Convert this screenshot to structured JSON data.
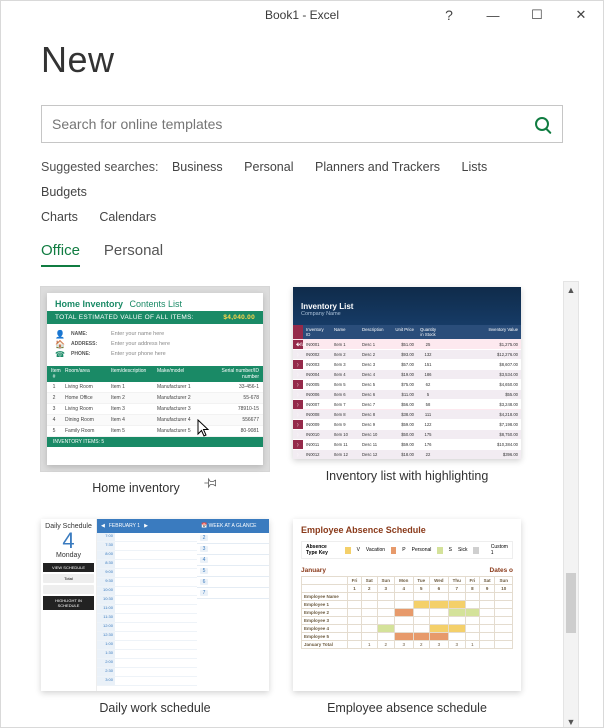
{
  "titlebar": {
    "title": "Book1  -  Excel",
    "help": "?",
    "min": "—",
    "max": "☐",
    "close": "✕"
  },
  "page": {
    "heading": "New"
  },
  "search": {
    "placeholder": "Search for online templates"
  },
  "suggested": {
    "label": "Suggested searches:",
    "items": [
      "Business",
      "Personal",
      "Planners and Trackers",
      "Lists",
      "Budgets",
      "Charts",
      "Calendars"
    ]
  },
  "tabs": {
    "active": "Office",
    "other": "Personal"
  },
  "templates": [
    {
      "id": "home-inventory",
      "caption": "Home inventory",
      "selected": true
    },
    {
      "id": "inventory-highlight",
      "caption": "Inventory list with highlighting",
      "selected": false
    },
    {
      "id": "daily-schedule",
      "caption": "Daily work schedule",
      "selected": false
    },
    {
      "id": "absence-schedule",
      "caption": "Employee absence schedule",
      "selected": false
    }
  ],
  "thumb1": {
    "title1": "Home Inventory",
    "title2": "Contents List",
    "barLabel": "TOTAL ESTIMATED VALUE OF ALL ITEMS:",
    "barValue": "$4,040.00",
    "infoRows": [
      {
        "icon": "👤",
        "k": "NAME:",
        "v": "Enter your name here"
      },
      {
        "icon": "🏠",
        "k": "ADDRESS:",
        "v": "Enter your address here"
      },
      {
        "icon": "☎",
        "k": "PHONE:",
        "v": "Enter your phone here"
      }
    ],
    "headers": [
      "Item #",
      "Room/area",
      "Item/description",
      "Make/model",
      "Serial number/ID number"
    ],
    "rows": [
      [
        "1",
        "Living Room",
        "Item 1",
        "Manufacturer 1",
        "33-456-1"
      ],
      [
        "2",
        "Home Office",
        "Item 2",
        "Manufacturer 2",
        "55-678"
      ],
      [
        "3",
        "Living Room",
        "Item 3",
        "Manufacturer 3",
        "78910-15"
      ],
      [
        "4",
        "Dining Room",
        "Item 4",
        "Manufacturer 4",
        "556677"
      ],
      [
        "5",
        "Family Room",
        "Item 5",
        "Manufacturer 5",
        "80-9081"
      ]
    ],
    "footer": "INVENTORY ITEMS: 5"
  },
  "thumb2": {
    "title": "Inventory List",
    "sub": "Company Name",
    "headers": [
      "",
      "Inventory ID",
      "Name",
      "Description",
      "Unit Price",
      "Quantity in Stock",
      "Inventory Value"
    ],
    "rows": [
      [
        "�flag",
        "IN0001",
        "Item 1",
        "Desc 1",
        "$51.00",
        "25",
        "$1,275.00"
      ],
      [
        "⟩",
        "IN0002",
        "Item 2",
        "Desc 2",
        "$93.00",
        "132",
        "$12,276.00"
      ],
      [
        "⟩",
        "IN0003",
        "Item 3",
        "Desc 3",
        "$57.00",
        "151",
        "$8,607.00"
      ],
      [
        "⟩",
        "IN0004",
        "Item 4",
        "Desc 4",
        "$19.00",
        "186",
        "$3,534.00"
      ],
      [
        "⟩",
        "IN0005",
        "Item 5",
        "Desc 5",
        "$75.00",
        "62",
        "$4,650.00"
      ],
      [
        "⟩",
        "IN0006",
        "Item 6",
        "Desc 6",
        "$11.00",
        "5",
        "$55.00"
      ],
      [
        "⟩",
        "IN0007",
        "Item 7",
        "Desc 7",
        "$56.00",
        "58",
        "$3,248.00"
      ],
      [
        "⟩",
        "IN0008",
        "Item 8",
        "Desc 8",
        "$38.00",
        "111",
        "$4,218.00"
      ],
      [
        "⟩",
        "IN0009",
        "Item 9",
        "Desc 9",
        "$59.00",
        "122",
        "$7,198.00"
      ],
      [
        "⟩",
        "IN0010",
        "Item 10",
        "Desc 10",
        "$50.00",
        "175",
        "$8,750.00"
      ],
      [
        "⟩",
        "IN0011",
        "Item 11",
        "Desc 11",
        "$59.00",
        "176",
        "$10,384.00"
      ],
      [
        "⟩",
        "IN0012",
        "Item 12",
        "Desc 12",
        "$18.00",
        "22",
        "$396.00"
      ]
    ],
    "highlightRows": [
      0,
      7
    ]
  },
  "thumb3": {
    "header": "Daily Schedule",
    "bigNum": "4",
    "day": "Monday",
    "box1": "VIEW SCHEDULE",
    "wtLabel": "Total",
    "box2": "HIGHLIGHT IN SCHEDULE",
    "midTitle": "FEBRUARY 1",
    "slots": [
      "7:00",
      "7:30",
      "8:00",
      "8:30",
      "9:00",
      "9:30",
      "10:00",
      "10:30",
      "11:00",
      "11:30",
      "12:00",
      "12:30",
      "1:00",
      "1:30",
      "2:00",
      "2:30",
      "3:00"
    ],
    "rightTitle": "WEEK AT A GLANCE",
    "weekdays": [
      "2",
      "3",
      "4",
      "5",
      "6",
      "7"
    ]
  },
  "thumb4": {
    "title": "Employee Absence Schedule",
    "keyLabel": "Absence Type Key",
    "keys": [
      [
        "V",
        "Vacation",
        "#f4d06a"
      ],
      [
        "P",
        "Personal",
        "#e79a6b"
      ],
      [
        "S",
        "Sick",
        "#d4e29a"
      ],
      [
        "",
        "Custom 1",
        "#cfcfcf"
      ]
    ],
    "month": "January",
    "datesLabel": "Dates o",
    "days": [
      "Fri",
      "Sat",
      "Sun",
      "Mon",
      "Tue",
      "Wed",
      "Thu",
      "Fri",
      "Sat",
      "Sun"
    ],
    "nums": [
      "1",
      "2",
      "3",
      "4",
      "5",
      "6",
      "7",
      "8",
      "9",
      "10"
    ],
    "rows": [
      {
        "name": "Employee Name",
        "cells": [
          "",
          "",
          "",
          "",
          "",
          "",
          "",
          "",
          "",
          ""
        ]
      },
      {
        "name": "Employee 1",
        "cells": [
          "",
          "",
          "",
          "",
          "v",
          "v",
          "v",
          "",
          "",
          ""
        ]
      },
      {
        "name": "Employee 2",
        "cells": [
          "",
          "",
          "",
          "p",
          "",
          "",
          "s",
          "s",
          "",
          ""
        ]
      },
      {
        "name": "Employee 3",
        "cells": [
          "",
          "",
          "",
          "",
          "",
          "",
          "",
          "",
          "",
          ""
        ]
      },
      {
        "name": "Employee 4",
        "cells": [
          "",
          "",
          "s",
          "",
          "",
          "v",
          "v",
          "",
          "",
          ""
        ]
      },
      {
        "name": "Employee 5",
        "cells": [
          "",
          "",
          "",
          "p",
          "p",
          "p",
          "",
          "",
          "",
          ""
        ]
      },
      {
        "name": "January Total",
        "cells": [
          "",
          "1",
          "2",
          "3",
          "2",
          "3",
          "3",
          "1",
          "",
          ""
        ]
      }
    ]
  }
}
